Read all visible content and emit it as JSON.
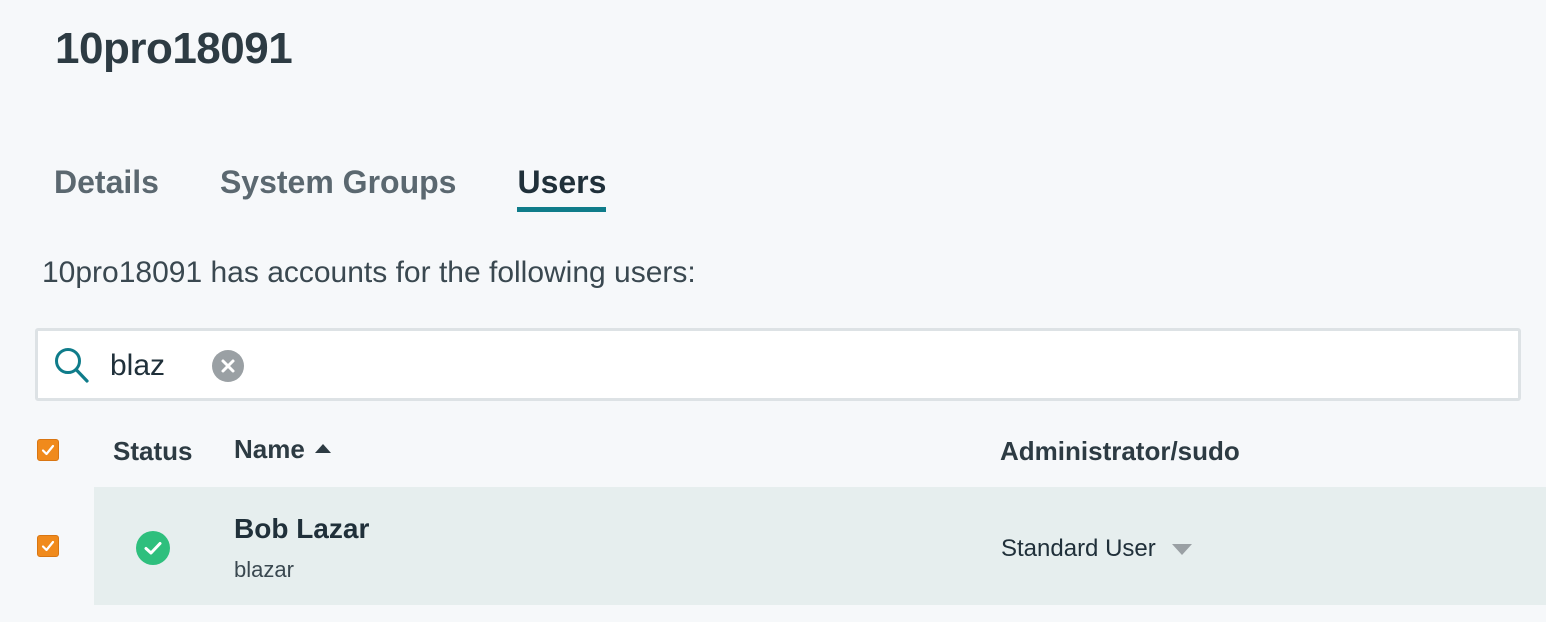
{
  "page": {
    "title": "10pro18091"
  },
  "tabs": [
    {
      "label": "Details",
      "active": false
    },
    {
      "label": "System Groups",
      "active": false
    },
    {
      "label": "Users",
      "active": true
    }
  ],
  "description": "10pro18091 has accounts for the following users:",
  "search": {
    "value": "blaz",
    "icon": "search-icon",
    "clear_icon": "clear-icon"
  },
  "table": {
    "select_all_checked": true,
    "headers": {
      "status": "Status",
      "name": "Name",
      "name_sort": "ascending",
      "admin": "Administrator/sudo"
    },
    "rows": [
      {
        "checked": true,
        "status": "active",
        "name": "Bob Lazar",
        "username": "blazar",
        "role": "Standard User"
      }
    ]
  },
  "colors": {
    "accent": "#0f7c8a",
    "checkbox": "#f08a1c",
    "status_ok": "#2ebf7d",
    "row_highlight": "#e6eeee"
  }
}
